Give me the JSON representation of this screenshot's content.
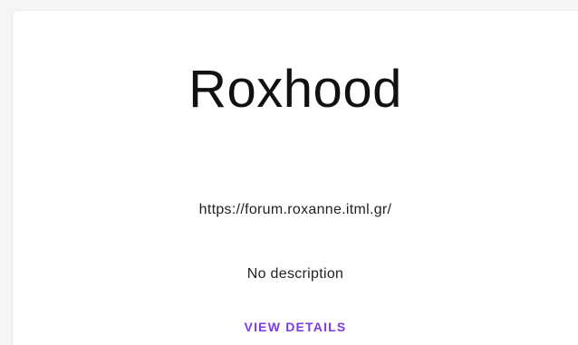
{
  "card": {
    "title": "Roxhood",
    "url": "https://forum.roxanne.itml.gr/",
    "description": "No description",
    "action_label": "VIEW DETAILS"
  },
  "colors": {
    "accent": "#7c3aed",
    "text": "#222222",
    "title": "#111111",
    "background": "#ffffff"
  }
}
